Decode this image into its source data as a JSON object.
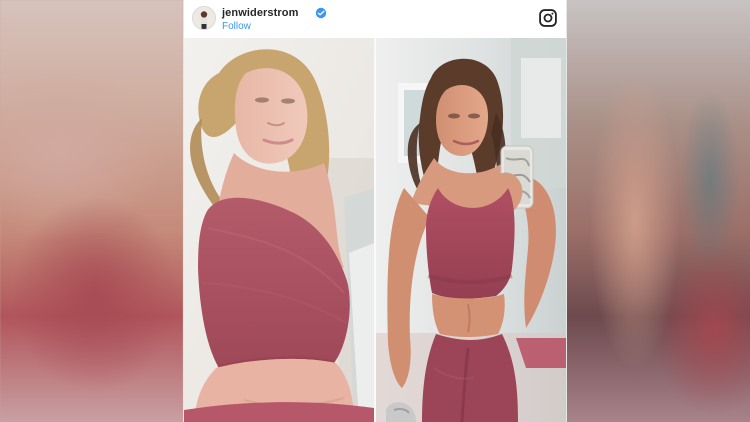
{
  "post": {
    "username": "jenwiderstrom",
    "follow_label": "Follow",
    "verified": true
  },
  "icons": {
    "avatar": "profile-avatar",
    "verified": "verified-badge-icon",
    "instagram": "instagram-icon"
  },
  "colors": {
    "follow_blue": "#3897f0",
    "verified_blue": "#3897f0",
    "text_dark": "#262626",
    "activewear": "#a24a5a"
  }
}
